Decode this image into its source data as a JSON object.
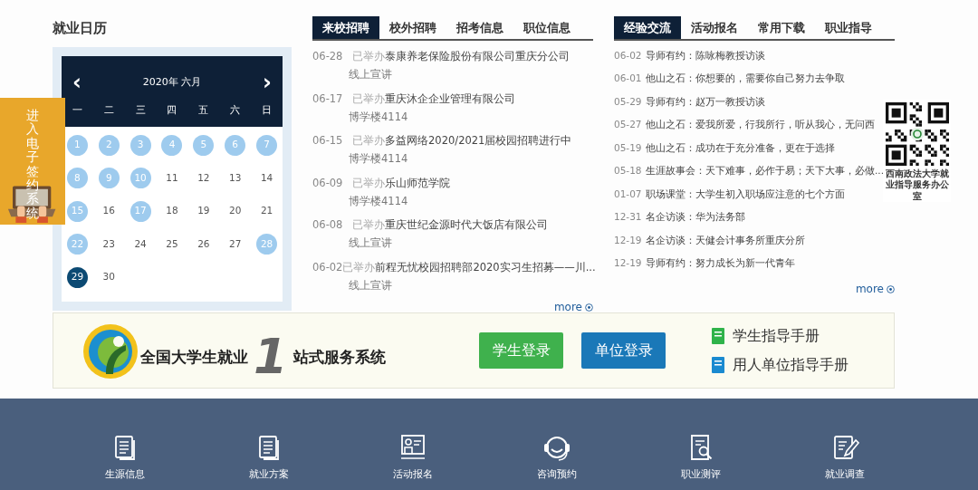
{
  "calendar": {
    "title": "就业日历",
    "month_label": "2020年 六月",
    "prev": "‹",
    "next": "›",
    "weekdays": [
      "一",
      "二",
      "三",
      "四",
      "五",
      "六",
      "日"
    ],
    "days": [
      {
        "day": "1",
        "kind": "event"
      },
      {
        "day": "2",
        "kind": "event"
      },
      {
        "day": "3",
        "kind": "event"
      },
      {
        "day": "4",
        "kind": "event"
      },
      {
        "day": "5",
        "kind": "event"
      },
      {
        "day": "6",
        "kind": "event"
      },
      {
        "day": "7",
        "kind": "event"
      },
      {
        "day": "8",
        "kind": "event"
      },
      {
        "day": "9",
        "kind": "event"
      },
      {
        "day": "10",
        "kind": "event"
      },
      {
        "day": "11",
        "kind": "plain"
      },
      {
        "day": "12",
        "kind": "plain"
      },
      {
        "day": "13",
        "kind": "plain"
      },
      {
        "day": "14",
        "kind": "plain"
      },
      {
        "day": "15",
        "kind": "event"
      },
      {
        "day": "16",
        "kind": "plain"
      },
      {
        "day": "17",
        "kind": "event"
      },
      {
        "day": "18",
        "kind": "plain"
      },
      {
        "day": "19",
        "kind": "plain"
      },
      {
        "day": "20",
        "kind": "plain"
      },
      {
        "day": "21",
        "kind": "plain"
      },
      {
        "day": "22",
        "kind": "event"
      },
      {
        "day": "23",
        "kind": "plain"
      },
      {
        "day": "24",
        "kind": "plain"
      },
      {
        "day": "25",
        "kind": "plain"
      },
      {
        "day": "26",
        "kind": "plain"
      },
      {
        "day": "27",
        "kind": "plain"
      },
      {
        "day": "28",
        "kind": "event"
      },
      {
        "day": "29",
        "kind": "today"
      },
      {
        "day": "30",
        "kind": "plain"
      }
    ]
  },
  "side_banner": {
    "text": "进入电子签约系统"
  },
  "recruit": {
    "tabs": [
      {
        "label": "来校招聘",
        "selected": true
      },
      {
        "label": "校外招聘",
        "selected": false
      },
      {
        "label": "招考信息",
        "selected": false
      },
      {
        "label": "职位信息",
        "selected": false
      }
    ],
    "items": [
      {
        "date": "06-28",
        "status": "已举办",
        "title": "泰康养老保险股份有限公司重庆分公司",
        "location": "线上宣讲"
      },
      {
        "date": "06-17",
        "status": "已举办",
        "title": "重庆沐企企业管理有限公司",
        "location": "博学楼4114"
      },
      {
        "date": "06-15",
        "status": "已举办",
        "title": "多益网络2020/2021届校园招聘进行中",
        "location": "博学楼4114"
      },
      {
        "date": "06-09",
        "status": "已举办",
        "title": "乐山师范学院",
        "location": "博学楼4114"
      },
      {
        "date": "06-08",
        "status": "已举办",
        "title": "重庆世纪金源时代大饭店有限公司",
        "location": "线上宣讲"
      },
      {
        "date": "06-02",
        "status": "已举办",
        "title": "前程无忧校园招聘部2020实习生招募——川...",
        "location": "线上宣讲"
      }
    ],
    "more": "more"
  },
  "experience": {
    "tabs": [
      {
        "label": "经验交流",
        "selected": true
      },
      {
        "label": "活动报名",
        "selected": false
      },
      {
        "label": "常用下载",
        "selected": false
      },
      {
        "label": "职业指导",
        "selected": false
      }
    ],
    "items": [
      {
        "date": "06-02",
        "title": "导师有约：陈咏梅教授访谈"
      },
      {
        "date": "06-01",
        "title": "他山之石：你想要的，需要你自己努力去争取"
      },
      {
        "date": "05-29",
        "title": "导师有约：赵万一教授访谈"
      },
      {
        "date": "05-27",
        "title": "他山之石：爱我所爱，行我所行，听从我心，无问西"
      },
      {
        "date": "05-19",
        "title": "他山之石：成功在于充分准备，更在于选择"
      },
      {
        "date": "05-18",
        "title": "生涯故事会：天下难事，必作于易；天下大事，必做..."
      },
      {
        "date": "01-07",
        "title": "职场课堂：大学生初入职场应注意的七个方面"
      },
      {
        "date": "12-31",
        "title": "名企访谈：华为法务部"
      },
      {
        "date": "12-19",
        "title": "名企访谈：天健会计事务所重庆分所"
      },
      {
        "date": "12-19",
        "title": "导师有约：努力成长为新一代青年"
      }
    ],
    "more": "more"
  },
  "qr": {
    "caption": "西南政法大学就业指导服务办公室"
  },
  "service_banner": {
    "logo_before": "全国大学生就业",
    "logo_digit": "1",
    "logo_after": "站式服务系统",
    "buttons": [
      {
        "label": "学生登录",
        "kind": "student"
      },
      {
        "label": "单位登录",
        "kind": "employer"
      }
    ],
    "links": [
      {
        "label": "学生指导手册",
        "color": "#2fb34a"
      },
      {
        "label": "用人单位指导手册",
        "color": "#1a8ad0"
      }
    ]
  },
  "footer": [
    {
      "label": "生源信息",
      "kind": "doc"
    },
    {
      "label": "就业方案",
      "kind": "doc"
    },
    {
      "label": "活动报名",
      "kind": "person"
    },
    {
      "label": "咨询预约",
      "kind": "headset"
    },
    {
      "label": "职业测评",
      "kind": "search"
    },
    {
      "label": "就业调查",
      "kind": "pen"
    }
  ]
}
